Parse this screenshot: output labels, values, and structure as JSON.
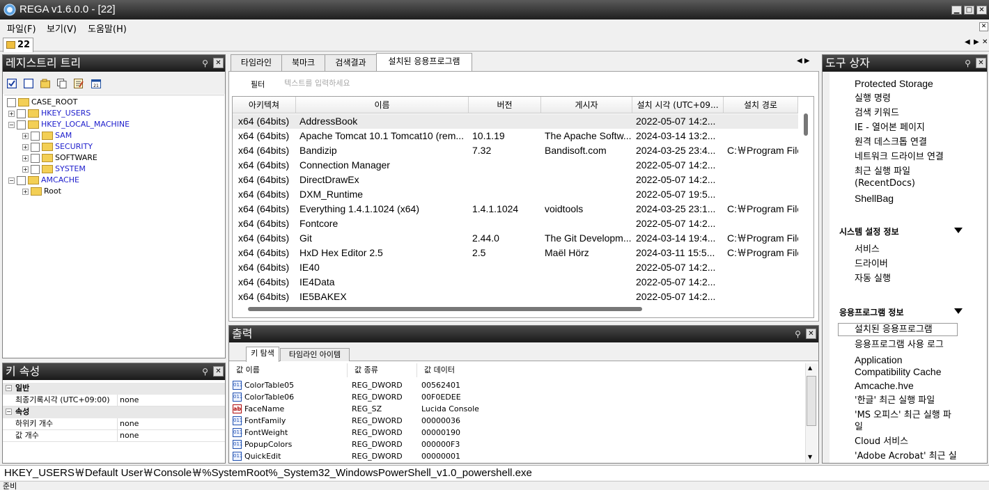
{
  "window": {
    "title": "REGA v1.6.0.0 - [22]"
  },
  "menu": {
    "file": "파일(F)",
    "view": "보기(V)",
    "help": "도움말(H)"
  },
  "doc_tab": {
    "label": "22"
  },
  "tree_panel": {
    "title": "레지스트리 트리",
    "nodes": [
      {
        "label": "CASE_ROOT"
      },
      {
        "label": "HKEY_USERS"
      },
      {
        "label": "HKEY_LOCAL_MACHINE"
      },
      {
        "label": "SAM"
      },
      {
        "label": "SECURITY"
      },
      {
        "label": "SOFTWARE"
      },
      {
        "label": "SYSTEM"
      },
      {
        "label": "AMCACHE"
      },
      {
        "label": "Root"
      }
    ]
  },
  "key_props": {
    "title": "키 속성",
    "sections": [
      {
        "name": "일반",
        "rows": [
          {
            "key": "최종기록시각 (UTC+09:00)",
            "value": "none"
          }
        ]
      },
      {
        "name": "속성",
        "rows": [
          {
            "key": "하위키 개수",
            "value": "none"
          },
          {
            "key": "값 개수",
            "value": "none"
          }
        ]
      }
    ]
  },
  "center": {
    "tabs": [
      "타임라인",
      "북마크",
      "검색결과",
      "설치된 응용프로그램"
    ],
    "active_tab": "설치된 응용프로그램",
    "filter_label": "필터",
    "filter_placeholder": "텍스트를 입력하세요",
    "columns": [
      "아키텍쳐",
      "이름",
      "버전",
      "게시자",
      "설치 시각 (UTC+09...",
      "설치 경로"
    ],
    "rows": [
      [
        "x64 (64bits)",
        "AddressBook",
        "",
        "",
        "2022-05-07  14:2...",
        ""
      ],
      [
        "x64 (64bits)",
        "Apache Tomcat 10.1 Tomcat10 (rem...",
        "10.1.19",
        "The Apache Softw...",
        "2024-03-14  13:2...",
        ""
      ],
      [
        "x64 (64bits)",
        "Bandizip",
        "7.32",
        "Bandisoft.com",
        "2024-03-25  23:4...",
        "C:￦Program Files"
      ],
      [
        "x64 (64bits)",
        "Connection Manager",
        "",
        "",
        "2022-05-07  14:2...",
        ""
      ],
      [
        "x64 (64bits)",
        "DirectDrawEx",
        "",
        "",
        "2022-05-07  14:2...",
        ""
      ],
      [
        "x64 (64bits)",
        "DXM_Runtime",
        "",
        "",
        "2022-05-07  19:5...",
        ""
      ],
      [
        "x64 (64bits)",
        "Everything 1.4.1.1024 (x64)",
        "1.4.1.1024",
        "voidtools",
        "2024-03-25  23:1...",
        "C:￦Program Files"
      ],
      [
        "x64 (64bits)",
        "Fontcore",
        "",
        "",
        "2022-05-07  14:2...",
        ""
      ],
      [
        "x64 (64bits)",
        "Git",
        "2.44.0",
        "The Git Developm...",
        "2024-03-14  19:4...",
        "C:￦Program Files"
      ],
      [
        "x64 (64bits)",
        "HxD Hex Editor 2.5",
        "2.5",
        "Maël Hörz",
        "2024-03-11  15:5...",
        "C:￦Program Files"
      ],
      [
        "x64 (64bits)",
        "IE40",
        "",
        "",
        "2022-05-07  14:2...",
        ""
      ],
      [
        "x64 (64bits)",
        "IE4Data",
        "",
        "",
        "2022-05-07  14:2...",
        ""
      ],
      [
        "x64 (64bits)",
        "IE5BAKEX",
        "",
        "",
        "2022-05-07  14:2...",
        ""
      ]
    ]
  },
  "output": {
    "title": "출력",
    "tabs": [
      "키 탐색",
      "타임라인 아이템"
    ],
    "columns": [
      "값 이름",
      "값 종류",
      "값 데이터"
    ],
    "rows": [
      {
        "icon": "binary-value-icon",
        "tag": "011",
        "name": "ColorTable05",
        "type": "REG_DWORD",
        "data": "00562401"
      },
      {
        "icon": "binary-value-icon",
        "tag": "011",
        "name": "ColorTable06",
        "type": "REG_DWORD",
        "data": "00F0EDEE"
      },
      {
        "icon": "string-value-icon",
        "tag": "ab",
        "name": "FaceName",
        "type": "REG_SZ",
        "data": "Lucida Console"
      },
      {
        "icon": "binary-value-icon",
        "tag": "011",
        "name": "FontFamily",
        "type": "REG_DWORD",
        "data": "00000036"
      },
      {
        "icon": "binary-value-icon",
        "tag": "011",
        "name": "FontWeight",
        "type": "REG_DWORD",
        "data": "00000190"
      },
      {
        "icon": "binary-value-icon",
        "tag": "011",
        "name": "PopupColors",
        "type": "REG_DWORD",
        "data": "000000F3"
      },
      {
        "icon": "binary-value-icon",
        "tag": "011",
        "name": "QuickEdit",
        "type": "REG_DWORD",
        "data": "00000001"
      }
    ]
  },
  "toolbox": {
    "title": "도구 상자",
    "items_top": [
      "Protected Storage",
      "실행 명령",
      "검색 키워드",
      "IE - 열어본 페이지",
      "원격 데스크톱 연결",
      "네트워크 드라이브 연결",
      "최근 실행 파일 (RecentDocs)",
      "ShellBag"
    ],
    "section_system": "시스템 설정 정보",
    "items_system": [
      "서비스",
      "드라이버",
      "자동 실행"
    ],
    "section_apps": "응용프로그램 정보",
    "items_apps": [
      "설치된 응용프로그램",
      "응용프로그램 사용 로그",
      "Application Compatibility Cache",
      "Amcache.hve",
      "'한글' 최근 실행 파일",
      "'MS 오피스' 최근 실행 파일",
      "Cloud 서비스",
      "'Adobe Acrobat' 최근 실"
    ],
    "selected_item": "설치된 응용프로그램"
  },
  "path_bar": "HKEY_USERS￦Default User￦Console￦%SystemRoot%_System32_WindowsPowerShell_v1.0_powershell.exe",
  "status_bar": "준비",
  "colors": {
    "title_bg": "#2b2b2b",
    "panel_header": "#2a2a2a",
    "link_blue": "#1c1ccc",
    "folder": "#f3cf55"
  }
}
